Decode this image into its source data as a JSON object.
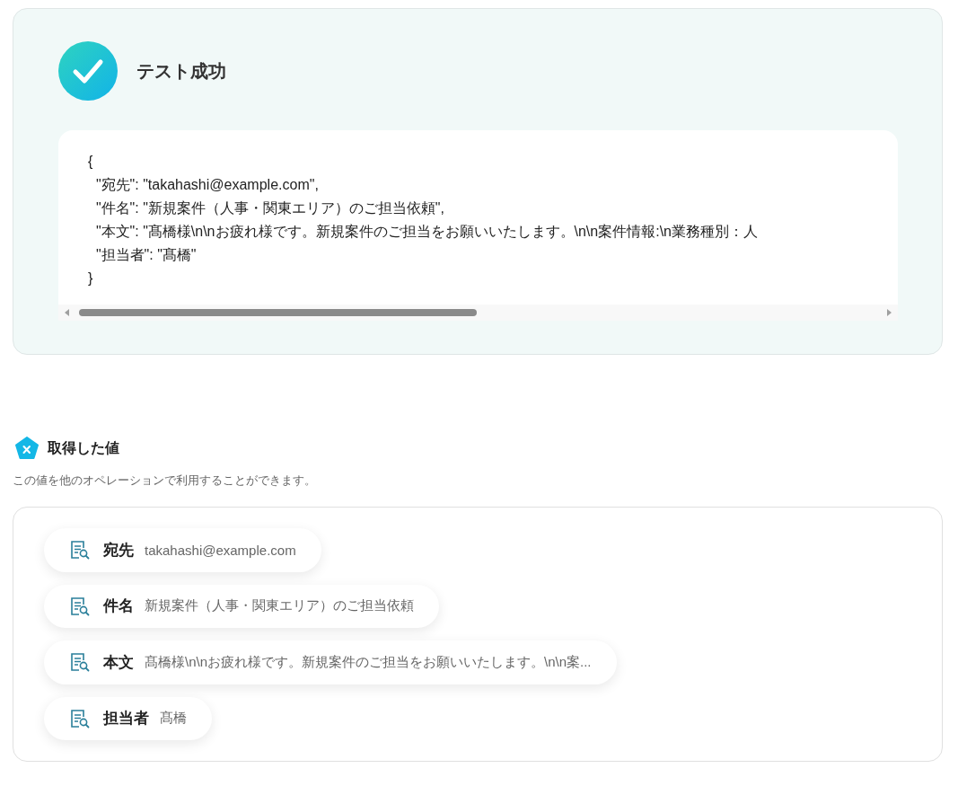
{
  "result": {
    "succeeded": true,
    "title": "テスト成功",
    "code_lines": [
      "{",
      "  \"宛先\": \"takahashi@example.com\",",
      "  \"件名\": \"新規案件（人事・関東エリア）のご担当依頼\",",
      "  \"本文\": \"髙橋様\\n\\nお疲れ様です。新規案件のご担当をお願いいたします。\\n\\n案件情報:\\n業務種別：人",
      "  \"担当者\": \"髙橋\"",
      "}"
    ]
  },
  "values": {
    "title": "取得した値",
    "description": "この値を他のオペレーションで利用することができます。",
    "items": [
      {
        "label": "宛先",
        "value": "takahashi@example.com"
      },
      {
        "label": "件名",
        "value": "新規案件（人事・関東エリア）のご担当依頼"
      },
      {
        "label": "本文",
        "value": "髙橋様\\n\\nお疲れ様です。新規案件のご担当をお願いいたします。\\n\\n案..."
      },
      {
        "label": "担当者",
        "value": "髙橋"
      }
    ]
  }
}
